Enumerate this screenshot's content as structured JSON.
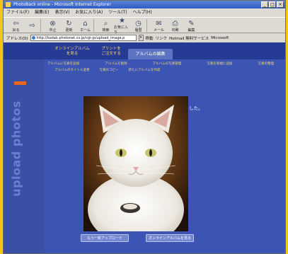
{
  "window": {
    "title": "PhotoBack online - Microsoft Internet Explorer"
  },
  "menu": [
    "ファイル(F)",
    "編集(E)",
    "表示(V)",
    "お気に入り(A)",
    "ツール(T)",
    "ヘルプ(H)"
  ],
  "toolbar": {
    "buttons": [
      {
        "label": "戻る",
        "icon": "back-arrow-icon"
      },
      {
        "label": "",
        "icon": "forward-arrow-icon"
      },
      {
        "label": "中止",
        "icon": "stop-icon"
      },
      {
        "label": "更新",
        "icon": "refresh-icon"
      },
      {
        "label": "ホーム",
        "icon": "home-icon"
      },
      {
        "label": "検索",
        "icon": "search-icon"
      },
      {
        "label": "お気に入り",
        "icon": "favorites-icon"
      },
      {
        "label": "履歴",
        "icon": "history-icon"
      },
      {
        "label": "メール",
        "icon": "mail-icon"
      },
      {
        "label": "印刷",
        "icon": "print-icon"
      },
      {
        "label": "編集",
        "icon": "edit-icon"
      }
    ]
  },
  "address": {
    "label": "アドレス(D)",
    "value": "http://kodak.photonet.co.jp/cgi-jp/upload_image.p",
    "go": "移動",
    "links": [
      "リンク",
      "Hotmail 無料サービス",
      "Microsoft"
    ]
  },
  "page": {
    "side_text": "upload photos",
    "nav_tabs": [
      {
        "line1": "オンラインアルバム",
        "line2": "を見る"
      },
      {
        "line1": "プリントを",
        "line2": "ご注文する"
      }
    ],
    "active_tab": "アルバムの編集",
    "subnav_row1": [
      "アルバムに写真を追加",
      "アルバムを削除",
      "アルバムの写真管理",
      "写真を新規に追加",
      "写真の整理"
    ],
    "subnav_row2": [
      "アルバムのタイトル変更",
      "写真のコピー",
      "新たにアルバムを作成"
    ],
    "message": "下の画像がオンラインアルバムに追加されました。",
    "buttons": [
      "もう一枚アップロード",
      "オンラインアルバムを見る"
    ]
  }
}
